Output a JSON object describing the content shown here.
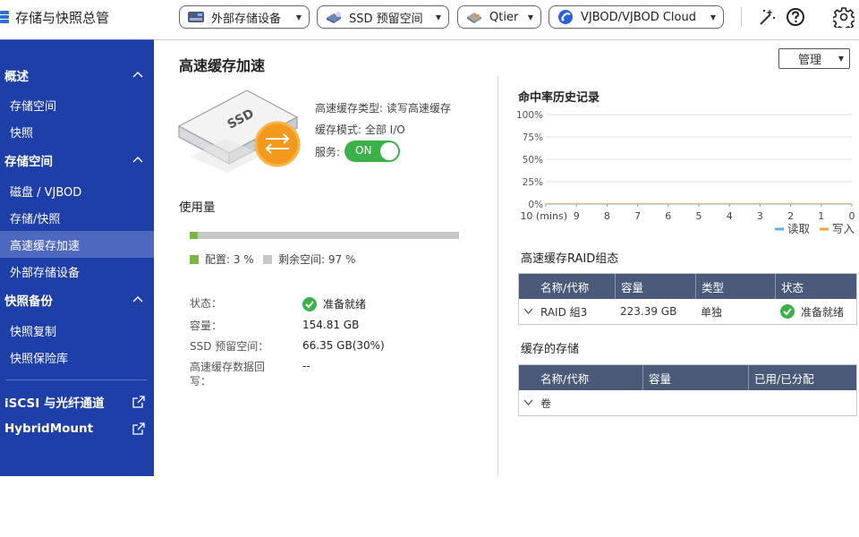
{
  "app": {
    "title": "存储与快照总管"
  },
  "toolbar": {
    "external_storage": "外部存储设备",
    "ssd_overprovision": "SSD 预留空间",
    "qtier": "Qtier",
    "vjbod": "VJBOD/VJBOD Cloud"
  },
  "sidebar": {
    "overview": {
      "label": "概述",
      "items": [
        "存储空间",
        "快照"
      ]
    },
    "storage": {
      "label": "存储空间",
      "items": [
        "磁盘 / VJBOD",
        "存储/快照",
        "高速缓存加速",
        "外部存储设备"
      ],
      "active_index": 2
    },
    "backup": {
      "label": "快照备份",
      "items": [
        "快照复制",
        "快照保险库"
      ]
    },
    "iscsi": "iSCSI 与光纤通道",
    "hybridmount": "HybridMount"
  },
  "main": {
    "title": "高速缓存加速",
    "manage": "管理",
    "ssd_label": "SSD",
    "cache_type": "高速缓存类型: 读写高速缓存",
    "cache_mode": "缓存模式: 全部 I/O",
    "service_label": "服务:",
    "service_toggle": "ON",
    "usage_title": "使用量",
    "usage": {
      "allocated_pct": 3,
      "allocated_label": "配置: 3 %",
      "free_label": "剩余空间: 97 %"
    },
    "details": [
      {
        "label": "状态：",
        "value": "准备就绪",
        "status": true
      },
      {
        "label": "容量：",
        "value": "154.81 GB"
      },
      {
        "label": "SSD 预留空间：",
        "value": "66.35 GB(30%)"
      },
      {
        "label": "高速缓存数据回写：",
        "value": "--"
      }
    ]
  },
  "chart_data": {
    "type": "line",
    "title": "命中率历史记录",
    "xlabel": "",
    "ylabel": "",
    "x": [
      "10 (mins)",
      "9",
      "8",
      "7",
      "6",
      "5",
      "4",
      "3",
      "2",
      "1",
      "0"
    ],
    "yticks": [
      "100%",
      "75%",
      "50%",
      "25%",
      "0%"
    ],
    "ylim": [
      0,
      100
    ],
    "series": [
      {
        "name": "读取",
        "color": "#5ab4e8",
        "values": [
          0,
          0,
          0,
          0,
          0,
          0,
          0,
          0,
          0,
          0,
          0
        ]
      },
      {
        "name": "写入",
        "color": "#f2a43a",
        "values": [
          0,
          0,
          0,
          0,
          0,
          0,
          0,
          0,
          0,
          0,
          0
        ]
      }
    ],
    "grid": true,
    "legend": "bottom-right"
  },
  "raid_table": {
    "title": "高速缓存RAID组态",
    "headers": [
      "名称/代称",
      "容量",
      "类型",
      "状态"
    ],
    "rows": [
      {
        "name": "RAID 組3",
        "capacity": "223.39 GB",
        "type": "单独",
        "status": "准备就绪"
      }
    ]
  },
  "storage_table": {
    "title": "缓存的存储",
    "headers": [
      "名称/代称",
      "容量",
      "已用/已分配"
    ],
    "rows": [
      {
        "name": "卷"
      }
    ]
  }
}
